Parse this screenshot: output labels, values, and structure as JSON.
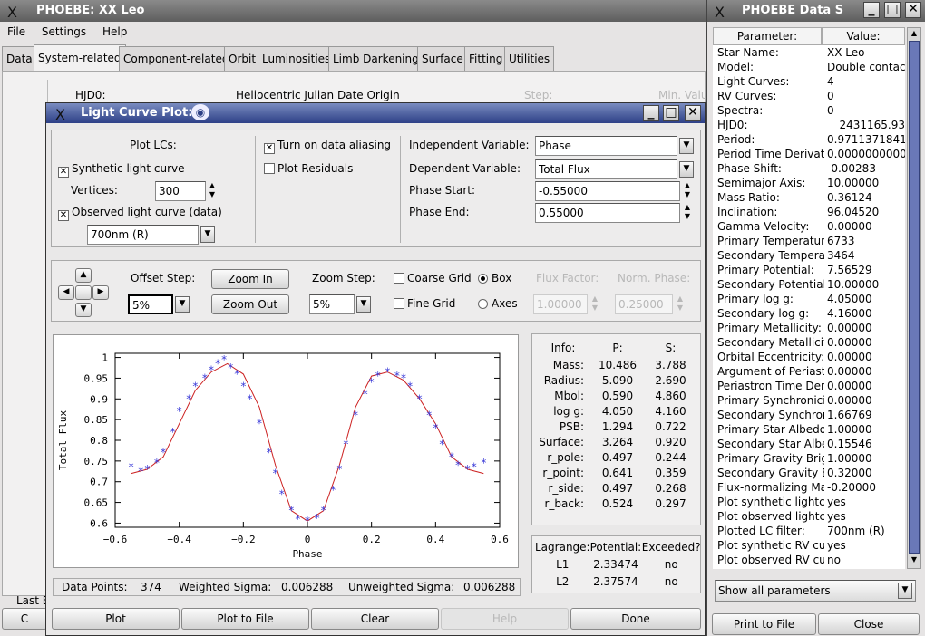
{
  "main_window": {
    "title": "PHOEBE: XX Leo",
    "menu": [
      "File",
      "Settings",
      "Help"
    ],
    "tabs": [
      "Data",
      "System-related",
      "Component-related",
      "Orbit",
      "Luminosities",
      "Limb Darkening",
      "Surface",
      "Fitting",
      "Utilities"
    ],
    "hjd_label": "HJD0:",
    "hjd_desc": "Heliocentric Julian Date Origin",
    "step_label": "Step:",
    "min_label": "Min. Value",
    "last_label": "Last E"
  },
  "plot_window": {
    "title": "Light Curve Plot:",
    "plot_lcs": "Plot LCs:",
    "synthetic": "Synthetic light curve",
    "vertices_label": "Vertices:",
    "vertices": "300",
    "observed": "Observed light curve (data)",
    "filter": "700nm (R)",
    "aliasing": "Turn on data aliasing",
    "residuals": "Plot Residuals",
    "indep_label": "Independent Variable:",
    "indep": "Phase",
    "dep_label": "Dependent Variable:",
    "dep": "Total Flux",
    "phase_start_label": "Phase Start:",
    "phase_start": "-0.55000",
    "phase_end_label": "Phase End:",
    "phase_end": "0.55000",
    "offset_label": "Offset Step:",
    "offset": "5%",
    "zoom_in": "Zoom In",
    "zoom_out": "Zoom Out",
    "zoom_label": "Zoom Step:",
    "zoom": "5%",
    "coarse": "Coarse Grid",
    "fine": "Fine Grid",
    "box": "Box",
    "axes": "Axes",
    "flux_label": "Flux Factor:",
    "flux": "1.00000",
    "norm_label": "Norm. Phase:",
    "norm": "0.25000",
    "info_head": [
      "Info:",
      "P:",
      "S:"
    ],
    "info_rows": [
      [
        "Mass:",
        "10.486",
        "3.788"
      ],
      [
        "Radius:",
        "5.090",
        "2.690"
      ],
      [
        "Mbol:",
        "0.590",
        "4.860"
      ],
      [
        "log g:",
        "4.050",
        "4.160"
      ],
      [
        "PSB:",
        "1.294",
        "0.722"
      ],
      [
        "Surface:",
        "3.264",
        "0.920"
      ],
      [
        "r_pole:",
        "0.497",
        "0.244"
      ],
      [
        "r_point:",
        "0.641",
        "0.359"
      ],
      [
        "r_side:",
        "0.497",
        "0.268"
      ],
      [
        "r_back:",
        "0.524",
        "0.297"
      ]
    ],
    "lag_head": [
      "Lagrange:",
      "Potential:",
      "Exceeded?"
    ],
    "lag_rows": [
      [
        "L1",
        "2.33474",
        "no"
      ],
      [
        "L2",
        "2.37574",
        "no"
      ]
    ],
    "dp_label": "Data Points:",
    "dp": "374",
    "ws_label": "Weighted Sigma:",
    "ws": "0.006288",
    "us_label": "Unweighted Sigma:",
    "us": "0.006288",
    "buttons": [
      "Plot",
      "Plot to File",
      "Clear",
      "Help",
      "Done"
    ]
  },
  "chart_data": {
    "type": "scatter",
    "xlabel": "Phase",
    "ylabel": "Total Flux",
    "xlim": [
      -0.6,
      0.6
    ],
    "ylim": [
      0.59,
      1.01
    ],
    "xticks": [
      "−0.6",
      "−0.4",
      "−0.2",
      "0",
      "0.2",
      "0.4",
      "0.6"
    ],
    "yticks": [
      "0.6",
      "0.65",
      "0.7",
      "0.75",
      "0.8",
      "0.85",
      "0.9",
      "0.95",
      "1"
    ],
    "series": [
      {
        "kind": "model_line",
        "color": "#cc2020",
        "x": [
          -0.55,
          -0.5,
          -0.45,
          -0.4,
          -0.35,
          -0.3,
          -0.25,
          -0.2,
          -0.15,
          -0.1,
          -0.05,
          0,
          0.05,
          0.1,
          0.15,
          0.2,
          0.25,
          0.3,
          0.35,
          0.4,
          0.45,
          0.5,
          0.55
        ],
        "y": [
          0.72,
          0.73,
          0.76,
          0.84,
          0.92,
          0.965,
          0.985,
          0.96,
          0.88,
          0.74,
          0.63,
          0.605,
          0.63,
          0.74,
          0.88,
          0.955,
          0.965,
          0.945,
          0.9,
          0.84,
          0.76,
          0.73,
          0.72
        ]
      },
      {
        "kind": "observed",
        "color": "#3a3ad8",
        "x": [
          -0.55,
          -0.52,
          -0.5,
          -0.47,
          -0.45,
          -0.42,
          -0.4,
          -0.37,
          -0.35,
          -0.32,
          -0.3,
          -0.28,
          -0.26,
          -0.24,
          -0.22,
          -0.2,
          -0.18,
          -0.15,
          -0.12,
          -0.1,
          -0.08,
          -0.05,
          -0.03,
          0,
          0.03,
          0.05,
          0.08,
          0.1,
          0.12,
          0.15,
          0.18,
          0.2,
          0.22,
          0.25,
          0.28,
          0.3,
          0.32,
          0.35,
          0.38,
          0.4,
          0.42,
          0.45,
          0.47,
          0.5,
          0.52,
          0.55
        ],
        "y": [
          0.735,
          0.725,
          0.73,
          0.745,
          0.77,
          0.82,
          0.87,
          0.9,
          0.93,
          0.95,
          0.97,
          0.985,
          0.995,
          0.975,
          0.96,
          0.93,
          0.9,
          0.84,
          0.77,
          0.72,
          0.67,
          0.63,
          0.61,
          0.605,
          0.612,
          0.63,
          0.68,
          0.73,
          0.79,
          0.86,
          0.91,
          0.94,
          0.955,
          0.965,
          0.955,
          0.95,
          0.93,
          0.9,
          0.86,
          0.83,
          0.79,
          0.76,
          0.74,
          0.73,
          0.735,
          0.745
        ]
      }
    ]
  },
  "data_window": {
    "title": "PHOEBE Data S",
    "col_param": "Parameter:",
    "col_value": "Value:",
    "rows": [
      [
        "Star Name:",
        "XX Leo"
      ],
      [
        "Model:",
        "Double contac"
      ],
      [
        "Light Curves:",
        "4"
      ],
      [
        "RV Curves:",
        "0"
      ],
      [
        "Spectra:",
        "0"
      ],
      [
        "HJD0:",
        "2431165.93"
      ],
      [
        "Period:",
        "0.9711371841"
      ],
      [
        "Period Time Derivati",
        "0.0000000000"
      ],
      [
        "Phase Shift:",
        "-0.00283"
      ],
      [
        "Semimajor Axis:",
        "10.00000"
      ],
      [
        "Mass Ratio:",
        "0.36124"
      ],
      [
        "Inclination:",
        "96.04520"
      ],
      [
        "Gamma Velocity:",
        "0.00000"
      ],
      [
        "Primary Temperature",
        "6733"
      ],
      [
        "Secondary Tempera",
        "3464"
      ],
      [
        "Primary Potential:",
        "7.56529"
      ],
      [
        "Secondary Potential",
        "10.00000"
      ],
      [
        "Primary log g:",
        "4.05000"
      ],
      [
        "Secondary log g:",
        "4.16000"
      ],
      [
        "Primary Metallicity:",
        "0.00000"
      ],
      [
        "Secondary Metallicit",
        "0.00000"
      ],
      [
        "Orbital Eccentricity:",
        "0.00000"
      ],
      [
        "Argument of Periastr",
        "0.00000"
      ],
      [
        "Periastron Time Deri",
        "0.00000"
      ],
      [
        "Primary Synchronici",
        "0.00000"
      ],
      [
        "Secondary Synchron",
        "1.66769"
      ],
      [
        "Primary Star Albedo:",
        "1.00000"
      ],
      [
        "Secondary Star Albe",
        "0.15546"
      ],
      [
        "Primary Gravity Brigl",
        "1.00000"
      ],
      [
        "Secondary Gravity B",
        "0.32000"
      ],
      [
        "Flux-normalizing Ma",
        "-0.20000"
      ],
      [
        "Plot synthetic lightcu",
        "yes"
      ],
      [
        "Plot observed lightcu",
        "yes"
      ],
      [
        "Plotted LC filter:",
        "700nm (R)"
      ],
      [
        "Plot synthetic RV cu",
        "yes"
      ],
      [
        "Plot observed RV cu",
        "no"
      ]
    ],
    "show_all": "Show all parameters",
    "print": "Print to File",
    "close": "Close"
  }
}
